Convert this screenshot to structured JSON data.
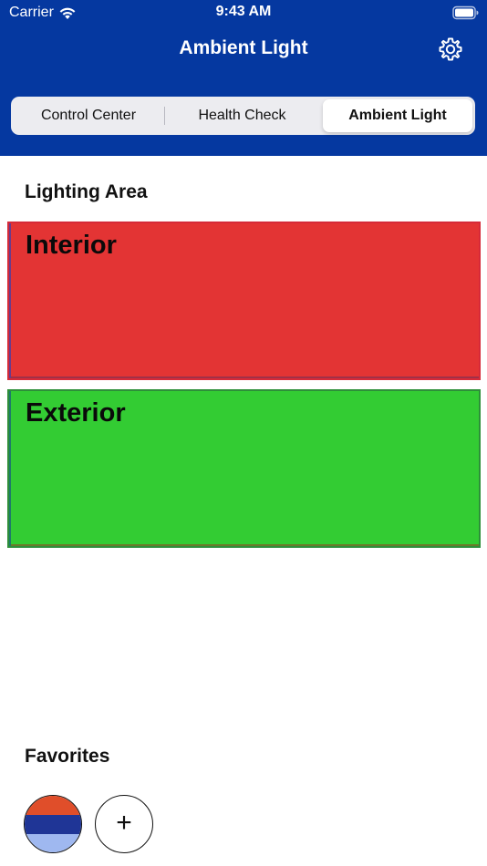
{
  "status_bar": {
    "carrier": "Carrier",
    "time": "9:43 AM",
    "wifi_icon": "wifi-icon",
    "battery_icon": "battery-icon"
  },
  "nav": {
    "title": "Ambient Light",
    "settings_icon": "gear-icon"
  },
  "tabs": [
    {
      "label": "Control Center",
      "active": false
    },
    {
      "label": "Health Check",
      "active": false
    },
    {
      "label": "Ambient Light",
      "active": true
    }
  ],
  "lighting_area": {
    "title": "Lighting Area",
    "areas": [
      {
        "label": "Interior",
        "color": "#e33434"
      },
      {
        "label": "Exterior",
        "color": "#33cc33"
      }
    ]
  },
  "favorites": {
    "title": "Favorites",
    "presets": [
      {
        "colors": [
          "#e04e2a",
          "#1f3596",
          "#9fb8f0"
        ]
      }
    ],
    "add_label": "+"
  },
  "colors": {
    "header": "#0538a0",
    "segment_bg": "#ececf0"
  }
}
